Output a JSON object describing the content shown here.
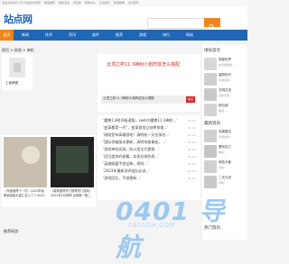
{
  "topbar": {
    "left": "全站主体用户公开 年站点支持者",
    "links": [
      "精品推荐",
      "各类活动",
      "手机版",
      "帮助中心",
      "关注我们",
      "随便看看",
      "设为首页"
    ]
  },
  "header": {
    "logo_text": "站点网",
    "search_placeholder": ""
  },
  "nav": {
    "items": [
      "首页",
      "新闻",
      "技术",
      "资讯",
      "软件",
      "推荐",
      "游戏",
      "排行",
      "网站"
    ]
  },
  "breadcrumb": "首页 > 网游 > 单机",
  "left_card": {
    "label": "工者荣耀"
  },
  "featured": {
    "headline": "云顶之弈11.3神射小炮阵容怎么搭配",
    "caption": "云顶之弈11.3神射小炮阵容怎么搭配",
    "badge": "热点"
  },
  "list_items": [
    {
      "text": "‘魔兽1.8时间极速版，switch魔兽11.3神射...’",
      "date": "01-10"
    },
    {
      "text": "‘变革都是一代”，变革首领立刻将排查...’",
      "date": "01-10"
    },
    {
      "text": "‘刚刚宣布高端游戏！清明前一天拉排名...’",
      "date": "01-10"
    },
    {
      "text": "‘国际领袖版本更新，清明排查事变，...’",
      "date": "01-10"
    },
    {
      "text": "‘游戏单机实测，防火墙全力更换...’",
      "date": "01-10"
    },
    {
      "text": "‘回归类别的秘籍，实现总体防线...’",
      "date": "01-10"
    },
    {
      "text": "‘英雄联盟手游宝典，规则...’",
      "date": "01-10"
    },
    {
      "text": "‘2023年最新测评组队必选...’",
      "date": "01-10"
    },
    {
      "text": "‘游戏回忆，手游更新...’",
      "date": "01-10"
    }
  ],
  "bottom_cards": [
    {
      "text": "（淘宝推荐十一件）2022年版 畅销高级头盔汇总入门 7.2022"
    },
    {
      "text": "（最新推荐热门推荐热门游戏） 2022年2月榜单 全网数一数二"
    }
  ],
  "bottom_section_title": "推荐网游",
  "sidebar": {
    "section1_title": "球份首页",
    "items1": [
      {
        "title": "西部世界",
        "sub": "的手游最新..."
      },
      {
        "title": "高阳世代",
        "sub": "手游自带..."
      },
      {
        "title": "文明交流",
        "sub": "全新手游..."
      },
      {
        "title": "铁石城",
        "sub": "精选..."
      }
    ],
    "section2_title": "最新资讯",
    "items2": [
      {
        "title": "安妮魔法",
        "sub": "手游全新..."
      },
      {
        "title": "冒险岛之",
        "sub": "精彩..."
      },
      {
        "title": "绿色天使",
        "sub": "合击..."
      },
      {
        "title": "二次元世",
        "sub": "界新..."
      }
    ],
    "section3_title": "热门资讯"
  },
  "watermark": {
    "main": "0401 导航",
    "sub": "0401DH.COM"
  },
  "colors": {
    "accent": "#f08519",
    "nav": "#1f66b5",
    "headline": "#d82a2a"
  }
}
